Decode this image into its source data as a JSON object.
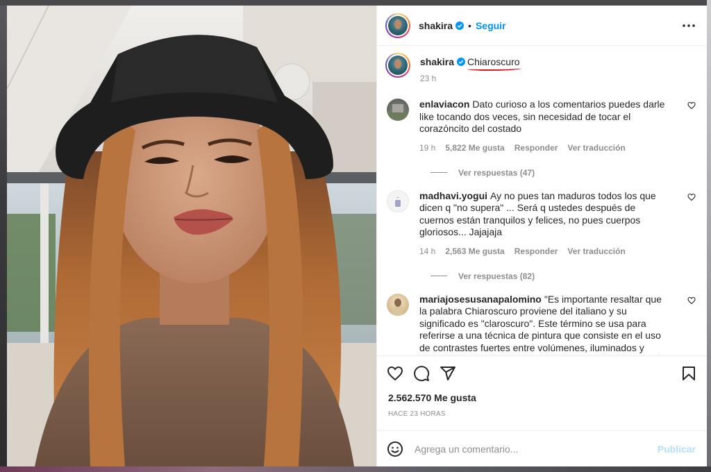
{
  "post": {
    "author": "shakira",
    "follow_label": "Seguir",
    "dot": "•",
    "caption": {
      "username": "shakira",
      "text": "Chiaroscuro",
      "time": "23 h"
    },
    "comments": [
      {
        "username": "enlaviacon",
        "text": "Dato curioso a los comentarios puedes darle like tocando dos veces, sin necesidad de tocar el corazóncito del costado",
        "time": "19 h",
        "likes": "5,822 Me gusta",
        "reply_label": "Responder",
        "translate_label": "Ver traducción",
        "replies_label": "Ver respuestas (47)"
      },
      {
        "username": "madhavi.yogui",
        "text": "Ay no pues tan maduros todos los que dicen q \"no supera\" ... Será q ustedes después de cuernos están tranquilos y felices, no pues cuerpos gloriosos... Jajajaja",
        "time": "14 h",
        "likes": "2,563 Me gusta",
        "reply_label": "Responder",
        "translate_label": "Ver traducción",
        "replies_label": "Ver respuestas (82)"
      },
      {
        "username": "mariajosesusanapalomino",
        "text": "\"Es importante resaltar que la palabra Chiaroscuro proviene del italiano y su significado es \"claroscuro\". Este término se usa para referirse a una técnica de pintura que consiste en el uso de contrastes fuertes entre volúmenes, iluminados y ensombrecidos, para destacar varios elementos.\" 👏 👏 👏 👏 😍"
      }
    ],
    "like_count": "2.562.570 Me gusta",
    "posted_ago": "HACE 23 HORAS",
    "comment_placeholder": "Agrega un comentario...",
    "publish_label": "Publicar"
  },
  "icons": {
    "verified": "verified-badge-icon",
    "more": "more-options-icon",
    "like": "heart-icon",
    "comment": "comment-icon",
    "share": "share-icon",
    "save": "bookmark-icon",
    "emoji": "emoji-icon"
  },
  "colors": {
    "link_blue": "#0095f6",
    "publish_disabled": "#b2dffc",
    "annotation_red": "#e0101a",
    "muted_text": "#8e8e8e"
  }
}
